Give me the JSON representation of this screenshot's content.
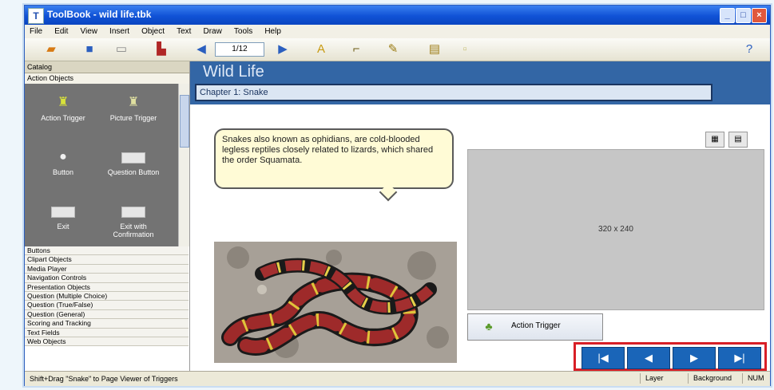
{
  "window": {
    "title": "ToolBook - wild life.tbk",
    "controls": {
      "minimize": "_",
      "maximize": "□",
      "close": "×"
    }
  },
  "menu": [
    "File",
    "Edit",
    "View",
    "Insert",
    "Object",
    "Text",
    "Draw",
    "Tools",
    "Help"
  ],
  "toolbar": {
    "page_field": "1/12",
    "icons": [
      "open-icon",
      "save-icon",
      "new-page-icon",
      "catalog-icon",
      "prev-page-icon",
      "next-page-icon",
      "text-icon",
      "draw-line-icon",
      "paint-icon",
      "properties-icon",
      "help-icon"
    ]
  },
  "left_panel": {
    "header": "Catalog",
    "subheader": "Action Objects",
    "objects": [
      {
        "label": "Action Trigger",
        "icon": "action-trigger-icon"
      },
      {
        "label": "Picture Trigger",
        "icon": "picture-trigger-icon"
      },
      {
        "label": "Button",
        "icon": "button-icon"
      },
      {
        "label": "Question Button",
        "icon": "question-button-icon"
      },
      {
        "label": "Exit",
        "icon": "exit-button-icon"
      },
      {
        "label": "Exit with Confirmation",
        "icon": "exit-confirm-button-icon"
      }
    ],
    "categories": [
      "Buttons",
      "Clipart Objects",
      "Media Player",
      "Navigation Controls",
      "Presentation Objects",
      "Question (Multiple Choice)",
      "Question (True/False)",
      "Question (General)",
      "Scoring and Tracking",
      "Text Fields",
      "Web Objects"
    ]
  },
  "canvas": {
    "page_title": "Wild Life",
    "chapter": "Chapter 1: Snake",
    "bubble_text": "Snakes also known as ophidians, are cold-blooded legless reptiles closely related to lizards, which shared the order Squamata.",
    "placeholder_label": "320 x 240",
    "view_buttons": [
      "lang-icon",
      "grid-icon"
    ],
    "action_trigger_label": "Action Trigger",
    "nav_buttons": [
      {
        "icon": "first-page-icon",
        "glyph": "|◀"
      },
      {
        "icon": "previous-page-icon",
        "glyph": "◀"
      },
      {
        "icon": "next-page-icon",
        "glyph": "▶"
      },
      {
        "icon": "last-page-icon",
        "glyph": "▶|"
      }
    ],
    "accent_color": "#1a65b8",
    "highlight_color": "#d81f26"
  },
  "status": {
    "message": "Shift+Drag \"Snake\" to Page Viewer of Triggers",
    "cells": [
      "Layer",
      "Background",
      "NUM"
    ]
  }
}
